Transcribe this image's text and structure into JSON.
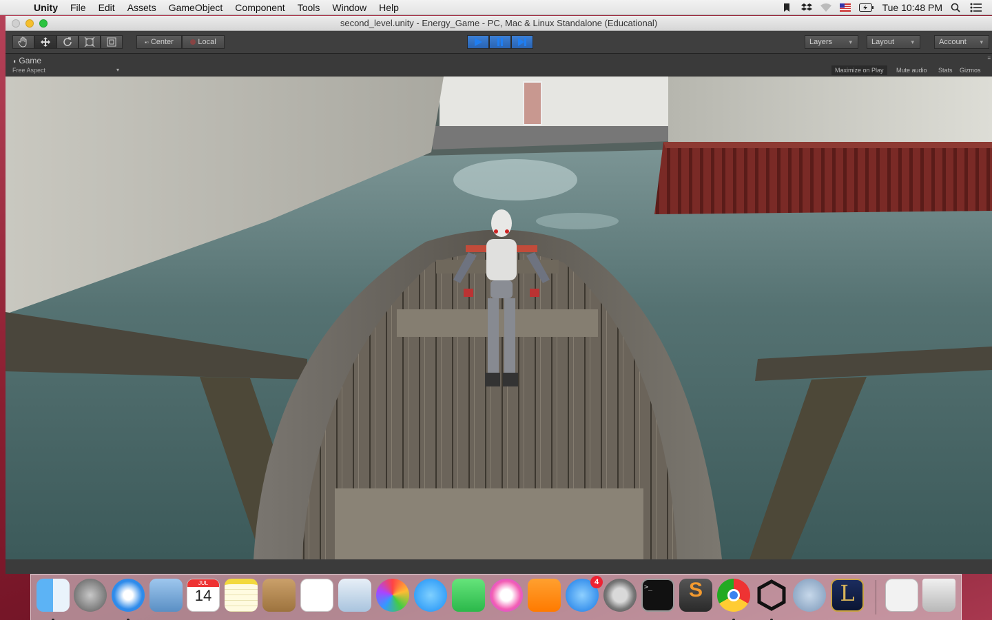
{
  "menubar": {
    "app_name": "Unity",
    "menus": [
      "File",
      "Edit",
      "Assets",
      "GameObject",
      "Component",
      "Tools",
      "Window",
      "Help"
    ],
    "clock": "Tue 10:48 PM"
  },
  "window": {
    "title": "second_level.unity - Energy_Game - PC, Mac & Linux Standalone (Educational)"
  },
  "toolbar": {
    "pivot_label": "Center",
    "space_label": "Local",
    "layers_label": "Layers",
    "layout_label": "Layout",
    "account_label": "Account"
  },
  "game_view": {
    "tab_label": "Game",
    "aspect_label": "Free Aspect",
    "options": [
      "Maximize on Play",
      "Mute audio",
      "Stats",
      "Gizmos"
    ]
  },
  "dock": {
    "calendar_month": "JUL",
    "calendar_day": "14",
    "app_store_badge": "4"
  },
  "colors": {
    "unity_play_active": "#2a64b3",
    "dark_panel": "#3f3f3f",
    "water": "#4f6c6c",
    "wall": "#d8d6cf"
  }
}
